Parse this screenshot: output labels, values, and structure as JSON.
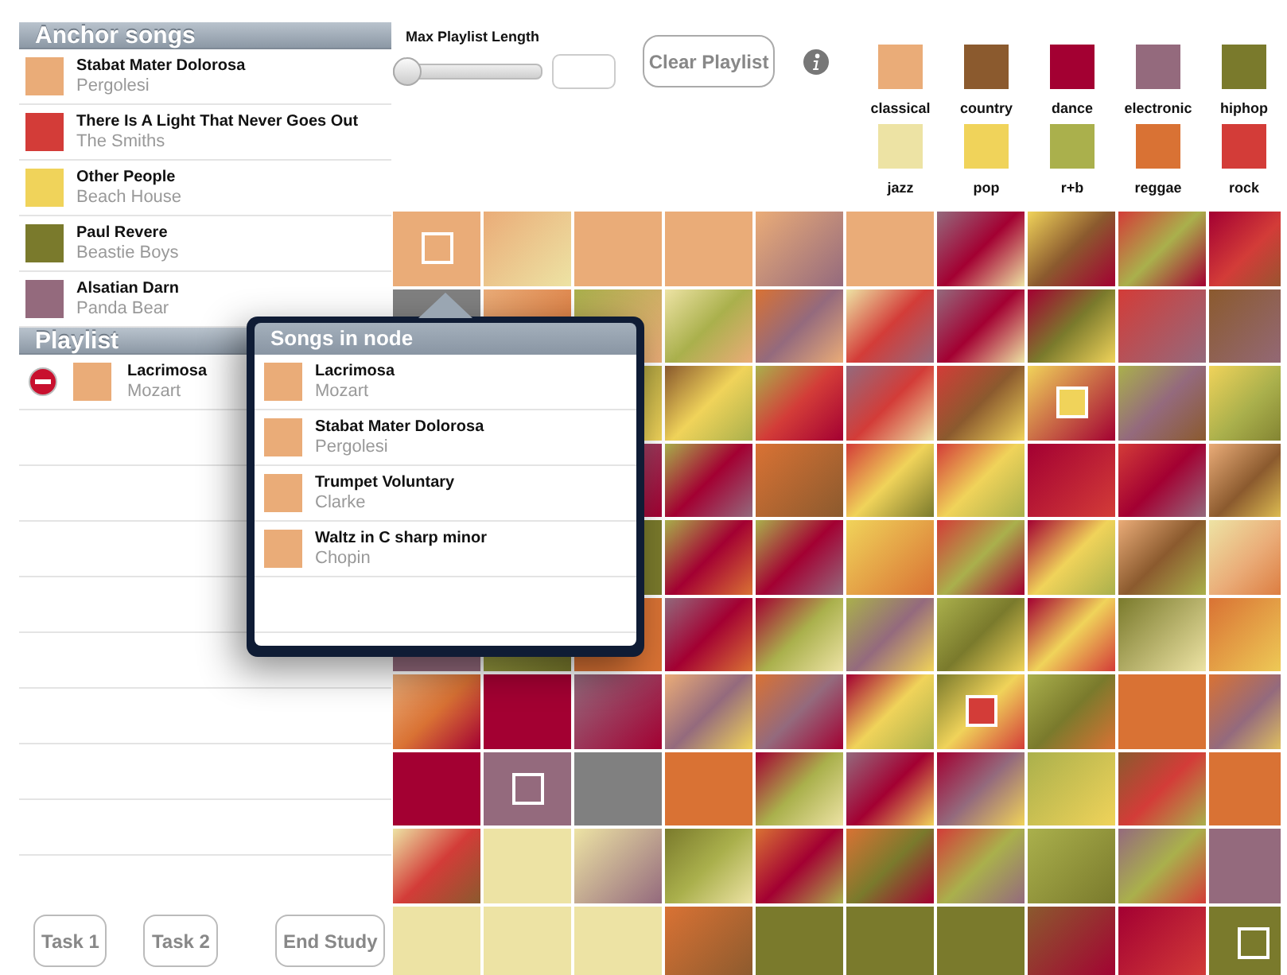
{
  "anchor_songs": {
    "title": "Anchor songs",
    "items": [
      {
        "title": "Stabat Mater Dolorosa",
        "artist": "Pergolesi",
        "color": "#eaac78"
      },
      {
        "title": "There Is A Light That Never Goes Out",
        "artist": "The Smiths",
        "color": "#d33c38"
      },
      {
        "title": "Other People",
        "artist": "Beach House",
        "color": "#f0d35a"
      },
      {
        "title": "Paul Revere",
        "artist": "Beastie Boys",
        "color": "#7a7a2c"
      },
      {
        "title": "Alsatian Darn",
        "artist": "Panda Bear",
        "color": "#946a7d"
      }
    ]
  },
  "playlist": {
    "title": "Playlist",
    "items": [
      {
        "title": "Lacrimosa",
        "artist": "Mozart",
        "color": "#eaac78"
      }
    ]
  },
  "buttons": [
    "Task 1",
    "Task 2",
    "End Study"
  ],
  "controls": {
    "slider_label": "Max Playlist Length",
    "level": 0,
    "clear_button": "Clear Playlist"
  },
  "legend": [
    {
      "label": "classical",
      "color": "#eaac78"
    },
    {
      "label": "country",
      "color": "#8b5a2e"
    },
    {
      "label": "dance",
      "color": "#a30032"
    },
    {
      "label": "electronic",
      "color": "#946a7d"
    },
    {
      "label": "hiphop",
      "color": "#7a7a2c"
    },
    {
      "label": "jazz",
      "color": "#ede3a4"
    },
    {
      "label": "pop",
      "color": "#f0d35a"
    },
    {
      "label": "r+b",
      "color": "#aab04c"
    },
    {
      "label": "reggae",
      "color": "#d97234"
    },
    {
      "label": "rock",
      "color": "#d33c38"
    }
  ],
  "popover": {
    "title": "Songs in node",
    "items": [
      {
        "title": "Lacrimosa",
        "artist": "Mozart",
        "color": "#eaac78"
      },
      {
        "title": "Stabat Mater Dolorosa",
        "artist": "Pergolesi",
        "color": "#eaac78"
      },
      {
        "title": "Trumpet Voluntary",
        "artist": "Clarke",
        "color": "#eaac78"
      },
      {
        "title": "Waltz in C sharp minor",
        "artist": "Chopin",
        "color": "#eaac78"
      }
    ]
  }
}
